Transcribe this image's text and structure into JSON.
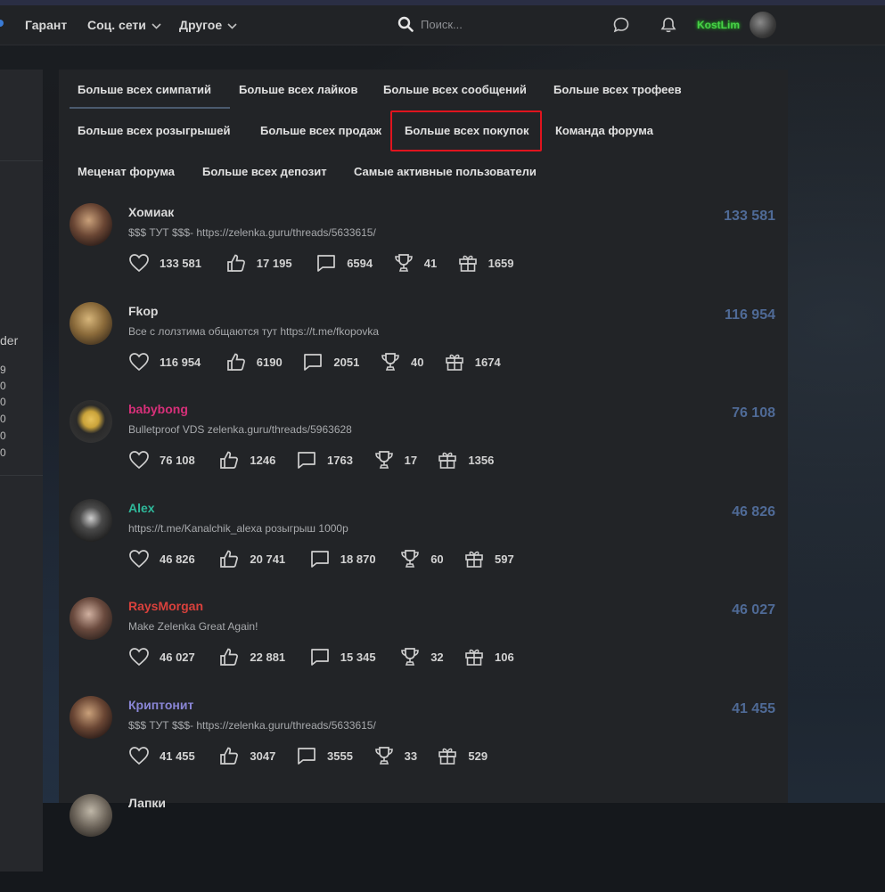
{
  "header": {
    "nav": [
      {
        "label": "Гарант"
      },
      {
        "label": "Соц. сети"
      },
      {
        "label": "Другое"
      }
    ],
    "search_placeholder": "Поиск...",
    "username": "KostLim"
  },
  "sidebar": {
    "partial_label": "der",
    "partial_numbers": [
      "9",
      "0",
      "0",
      "0",
      "0",
      "0"
    ]
  },
  "tabs": [
    {
      "label": "Больше всех симпатий"
    },
    {
      "label": "Больше всех лайков"
    },
    {
      "label": "Больше всех сообщений"
    },
    {
      "label": "Больше всех трофеев"
    },
    {
      "label": "Больше всех розыгрышей"
    },
    {
      "label": "Больше всех продаж"
    },
    {
      "label": "Больше всех покупок"
    },
    {
      "label": "Команда форума"
    },
    {
      "label": "Меценат форума"
    },
    {
      "label": "Больше всех депозит"
    },
    {
      "label": "Самые активные пользователи"
    }
  ],
  "users": [
    {
      "name": "Хомиак",
      "name_color": "#d9d9d9",
      "status": "$$$ ТУТ $$$- https://zelenka.guru/threads/5633615/",
      "score": "133 581",
      "stats": {
        "sympathy": "133 581",
        "likes": "17 195",
        "messages": "6594",
        "trophies": "41",
        "giveaways": "1659"
      }
    },
    {
      "name": "Fkop",
      "name_color": "#d9d9d9",
      "status": "Все с лолзтима общаются тут https://t.me/fkopovka",
      "score": "116 954",
      "stats": {
        "sympathy": "116 954",
        "likes": "6190",
        "messages": "2051",
        "trophies": "40",
        "giveaways": "1674"
      }
    },
    {
      "name": "babybong",
      "name_color": "#d8307a",
      "status": "Bulletproof VDS zelenka.guru/threads/5963628",
      "score": "76 108",
      "stats": {
        "sympathy": "76 108",
        "likes": "1246",
        "messages": "1763",
        "trophies": "17",
        "giveaways": "1356"
      }
    },
    {
      "name": "Alex",
      "name_color": "#2fb89a",
      "status": "https://t.me/Kanalchik_alexa розыгрыш 1000р",
      "score": "46 826",
      "stats": {
        "sympathy": "46 826",
        "likes": "20 741",
        "messages": "18 870",
        "trophies": "60",
        "giveaways": "597"
      }
    },
    {
      "name": "RaysMorgan",
      "name_color": "#d9413c",
      "status": "Make Zelenka Great Again!",
      "score": "46 027",
      "stats": {
        "sympathy": "46 027",
        "likes": "22 881",
        "messages": "15 345",
        "trophies": "32",
        "giveaways": "106"
      }
    },
    {
      "name": "Криптонит",
      "name_color": "#8a86d6",
      "status": "$$$ ТУТ $$$- https://zelenka.guru/threads/5633615/",
      "score": "41 455",
      "stats": {
        "sympathy": "41 455",
        "likes": "3047",
        "messages": "3555",
        "trophies": "33",
        "giveaways": "529"
      }
    },
    {
      "name": "Лапки",
      "name_color": "#d9d9d9",
      "status": "",
      "score": "",
      "stats": {
        "sympathy": "",
        "likes": "",
        "messages": "",
        "trophies": "",
        "giveaways": ""
      }
    }
  ]
}
